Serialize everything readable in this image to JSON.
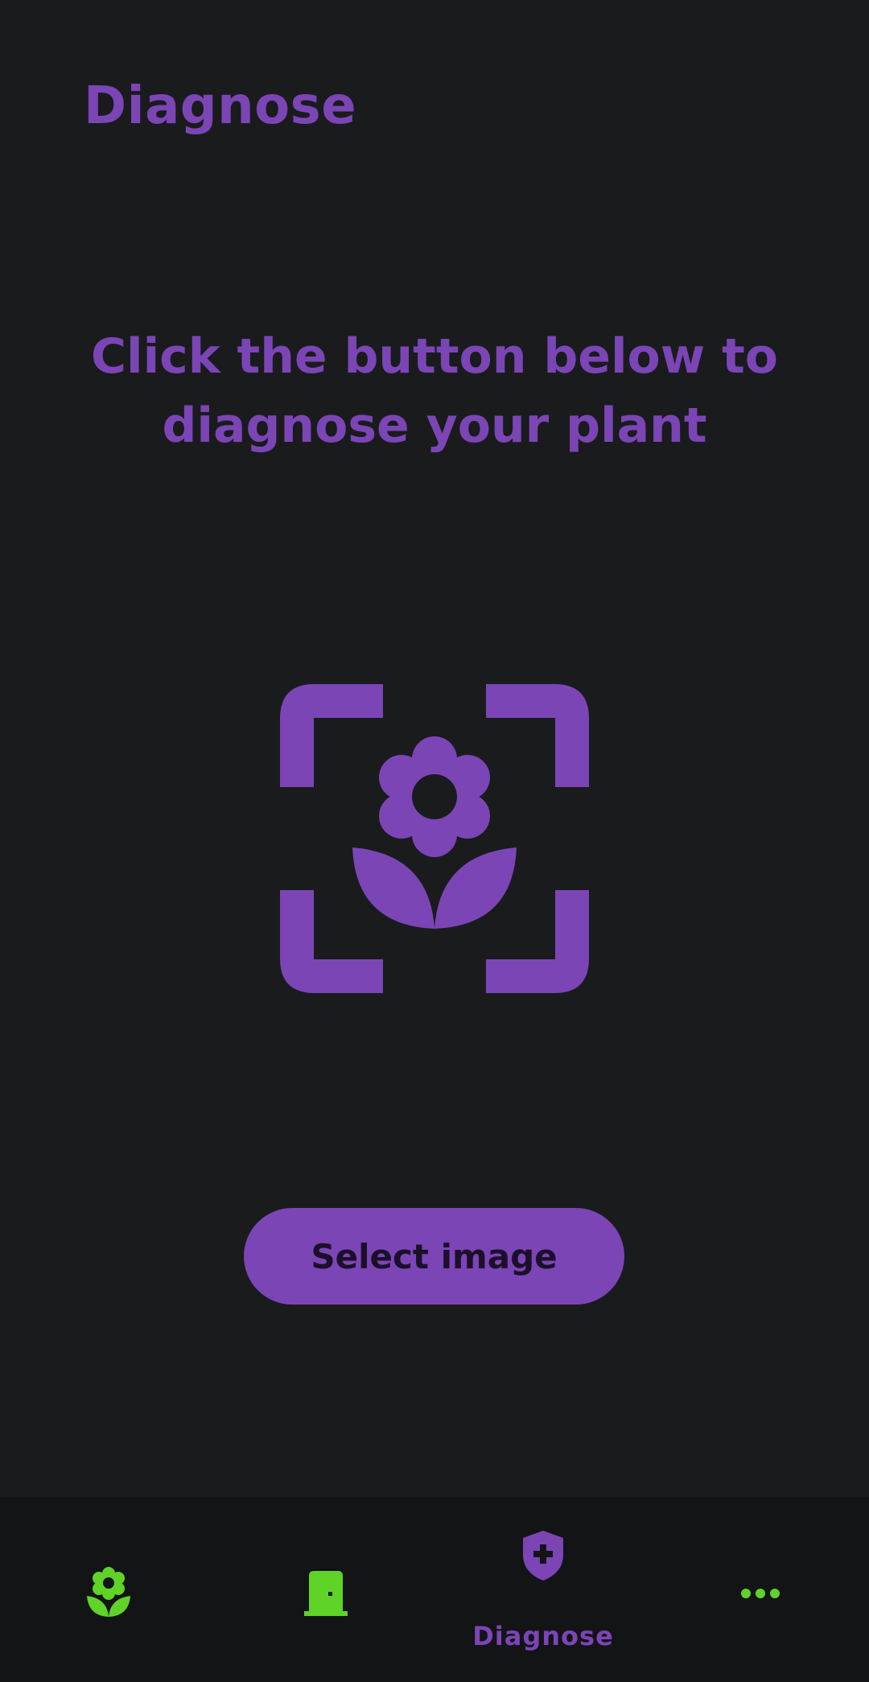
{
  "header": {
    "title": "Diagnose"
  },
  "main": {
    "prompt_line1": "Click the button below to",
    "prompt_line2": "diagnose your plant",
    "select_button_label": "Select image"
  },
  "bottom_nav": {
    "items": [
      {
        "icon": "flower-icon",
        "label": ""
      },
      {
        "icon": "door-icon",
        "label": ""
      },
      {
        "icon": "shield-plus-icon",
        "label": "Diagnose",
        "active": true
      },
      {
        "icon": "more-dots-icon",
        "label": ""
      }
    ]
  },
  "colors": {
    "background": "#1a1b1d",
    "accent_purple": "#7b45b6",
    "accent_green": "#5fd327",
    "nav_background": "#131416"
  }
}
